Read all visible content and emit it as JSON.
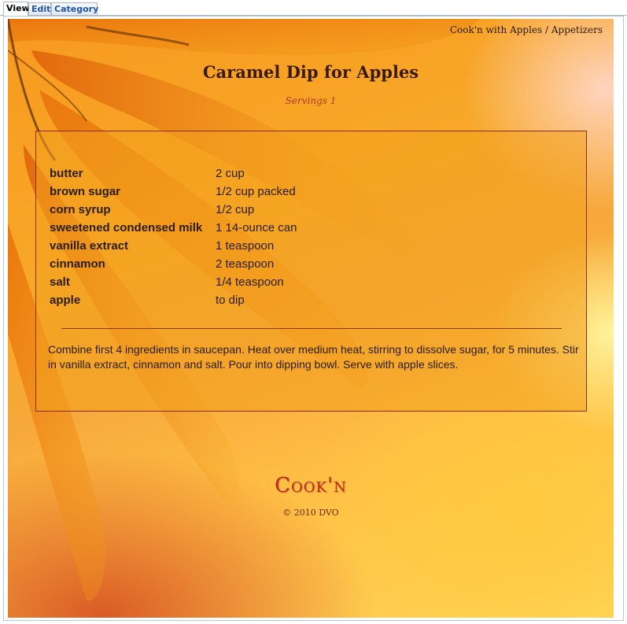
{
  "tabs": [
    {
      "label": "View"
    },
    {
      "label": "Edit"
    },
    {
      "label": "Category"
    }
  ],
  "breadcrumb": "Cook'n with Apples / Appetizers",
  "recipe": {
    "title": "Caramel Dip for Apples",
    "servings": "Servings 1",
    "ingredients": [
      {
        "name": "butter",
        "amount": "2 cup"
      },
      {
        "name": "brown sugar",
        "amount": "1/2 cup packed"
      },
      {
        "name": "corn syrup",
        "amount": "1/2 cup"
      },
      {
        "name": "sweetened condensed milk",
        "amount": "1 14-ounce can"
      },
      {
        "name": "vanilla extract",
        "amount": "1 teaspoon"
      },
      {
        "name": "cinnamon",
        "amount": "2 teaspoon"
      },
      {
        "name": "salt",
        "amount": "1/4 teaspoon"
      },
      {
        "name": "apple",
        "amount": "to dip"
      }
    ],
    "directions": "Combine first 4 ingredients in saucepan. Heat over medium heat, stirring to dissolve sugar, for 5 minutes. Stir in vanilla extract, cinnamon and salt. Pour into dipping bowl. Serve with apple slices."
  },
  "footer": {
    "logo": "Cook'n",
    "copyright": "© 2010 DVO"
  },
  "colors": {
    "accent": "#b03a1e",
    "tab_link": "#1f57a5",
    "background": "#f8a828"
  }
}
